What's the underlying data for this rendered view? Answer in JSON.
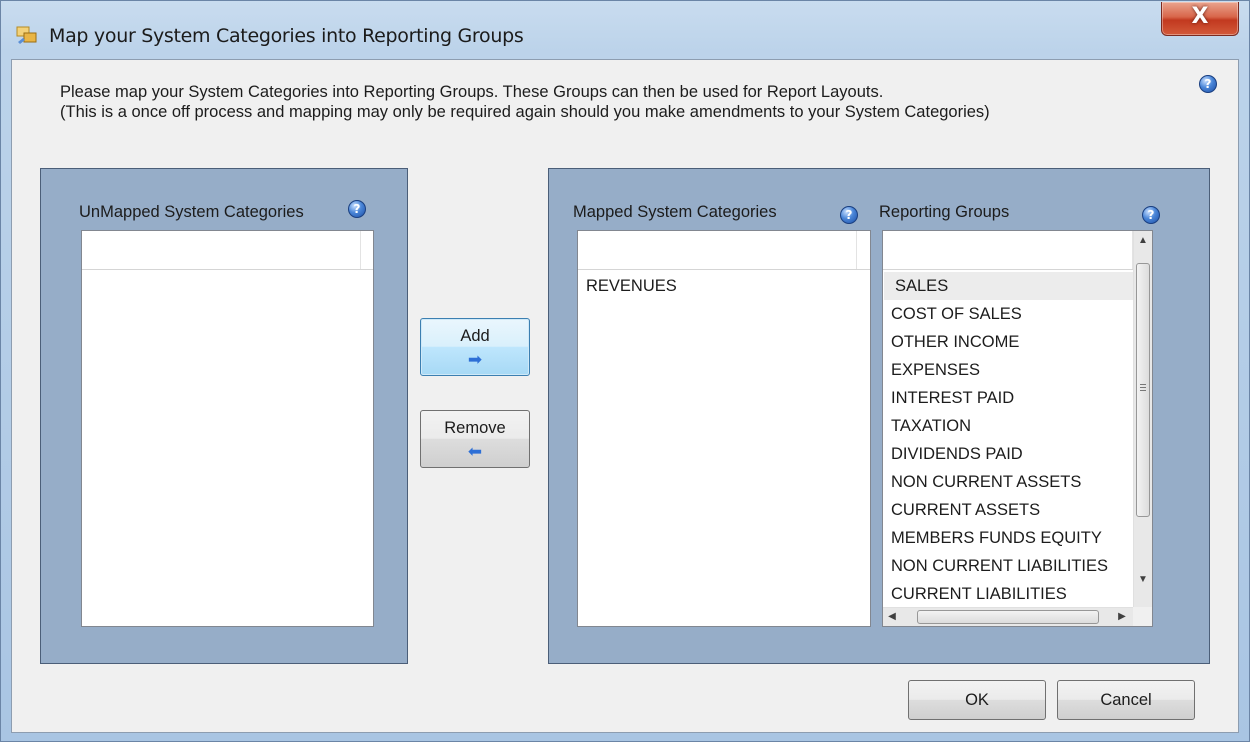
{
  "window": {
    "title": "Map your System Categories into Reporting Groups",
    "close_label": "X"
  },
  "intro": {
    "line1": "Please map your System Categories into Reporting Groups. These Groups can then be used for Report Layouts.",
    "line2": "(This is a once off process and mapping may only be required again should you make amendments to your System Categories)"
  },
  "unmapped": {
    "label": "UnMapped System Categories",
    "items": []
  },
  "mapped": {
    "label": "Mapped System Categories",
    "items": [
      "REVENUES"
    ]
  },
  "reporting": {
    "label": "Reporting Groups",
    "selected": "SALES",
    "items": [
      "SALES",
      "COST OF SALES",
      "OTHER INCOME",
      "EXPENSES",
      "INTEREST PAID",
      "TAXATION",
      "DIVIDENDS PAID",
      "NON CURRENT ASSETS",
      "CURRENT ASSETS",
      "MEMBERS FUNDS EQUITY",
      "NON CURRENT LIABILITIES",
      "CURRENT LIABILITIES"
    ]
  },
  "buttons": {
    "add": "Add",
    "remove": "Remove",
    "ok": "OK",
    "cancel": "Cancel"
  },
  "help": "?",
  "icons": {
    "add_arrow": "arrow-right-icon",
    "remove_arrow": "arrow-left-icon",
    "help": "help-icon"
  },
  "colors": {
    "panel_bg": "#96adc8",
    "accent_arrow": "#2d6fd6",
    "close_red": "#c2391f"
  }
}
